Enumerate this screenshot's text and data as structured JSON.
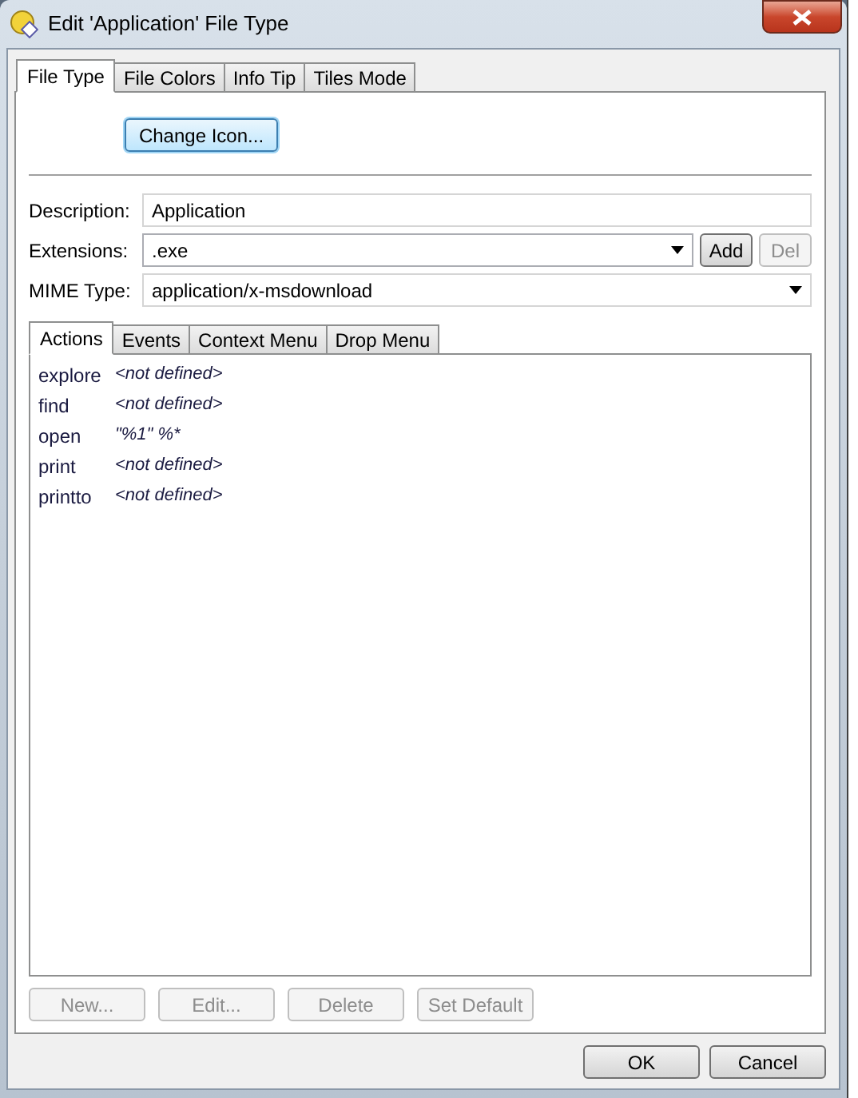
{
  "window": {
    "title": "Edit 'Application' File Type"
  },
  "tabs": [
    {
      "label": "File Type",
      "selected": true
    },
    {
      "label": "File Colors",
      "selected": false
    },
    {
      "label": "Info Tip",
      "selected": false
    },
    {
      "label": "Tiles Mode",
      "selected": false
    }
  ],
  "change_icon_button": "Change Icon...",
  "form": {
    "description": {
      "label": "Description:",
      "value": "Application"
    },
    "extensions": {
      "label": "Extensions:",
      "value": ".exe",
      "add_button": {
        "label": "Add",
        "disabled": false
      },
      "del_button": {
        "label": "Del",
        "disabled": true
      }
    },
    "mime_type": {
      "label": "MIME Type:",
      "value": "application/x-msdownload"
    }
  },
  "inner_tabs": [
    {
      "label": "Actions",
      "selected": true
    },
    {
      "label": "Events",
      "selected": false
    },
    {
      "label": "Context Menu",
      "selected": false
    },
    {
      "label": "Drop Menu",
      "selected": false
    }
  ],
  "actions": [
    {
      "name": "explore",
      "command": "<not defined>"
    },
    {
      "name": "find",
      "command": "<not defined>"
    },
    {
      "name": "open",
      "command": "\"%1\" %*"
    },
    {
      "name": "print",
      "command": "<not defined>"
    },
    {
      "name": "printto",
      "command": "<not defined>"
    }
  ],
  "action_buttons": [
    {
      "label": "New...",
      "disabled": true
    },
    {
      "label": "Edit...",
      "disabled": true
    },
    {
      "label": "Delete",
      "disabled": true
    },
    {
      "label": "Set Default",
      "disabled": true
    }
  ],
  "buttons": [
    "OK",
    "Cancel"
  ]
}
